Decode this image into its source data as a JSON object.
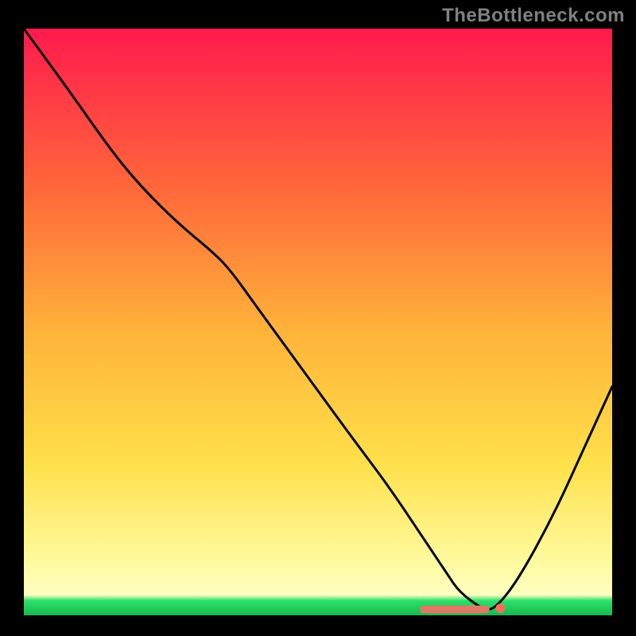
{
  "watermark": "TheBottleneck.com",
  "colors": {
    "bg_black": "#000000",
    "watermark_gray": "#808080",
    "gradient_top": "#ff1a4d",
    "gradient_mid_upper": "#ff6a3a",
    "gradient_mid": "#ffb43a",
    "gradient_mid_lower": "#ffe04a",
    "gradient_low": "#fff99a",
    "gradient_green": "#2ee06b",
    "curve_black": "#000000",
    "marker_fill": "#e07866",
    "marker_dot": "#ff6a5a"
  },
  "chart_data": {
    "type": "line",
    "title": "",
    "xlabel": "",
    "ylabel": "",
    "xlim": [
      0,
      100
    ],
    "ylim": [
      0,
      100
    ],
    "series": [
      {
        "name": "bottleneck-curve",
        "x": [
          0,
          8,
          15,
          20,
          26,
          32,
          35,
          40,
          48,
          56,
          62,
          68,
          72,
          74,
          78,
          80,
          84,
          90,
          95,
          100
        ],
        "values": [
          100,
          89,
          79,
          73,
          67,
          62,
          59,
          52,
          41,
          30,
          22,
          13,
          7,
          4,
          1,
          1,
          6,
          17,
          28,
          39
        ]
      }
    ],
    "markers": {
      "name": "highlight-band",
      "x": [
        68,
        69.5,
        71,
        72.5,
        74,
        75,
        76.5,
        78.5,
        81
      ],
      "values": [
        1.0,
        1.0,
        1.0,
        1.0,
        1.0,
        1.0,
        1.0,
        1.0,
        1.2
      ]
    }
  }
}
